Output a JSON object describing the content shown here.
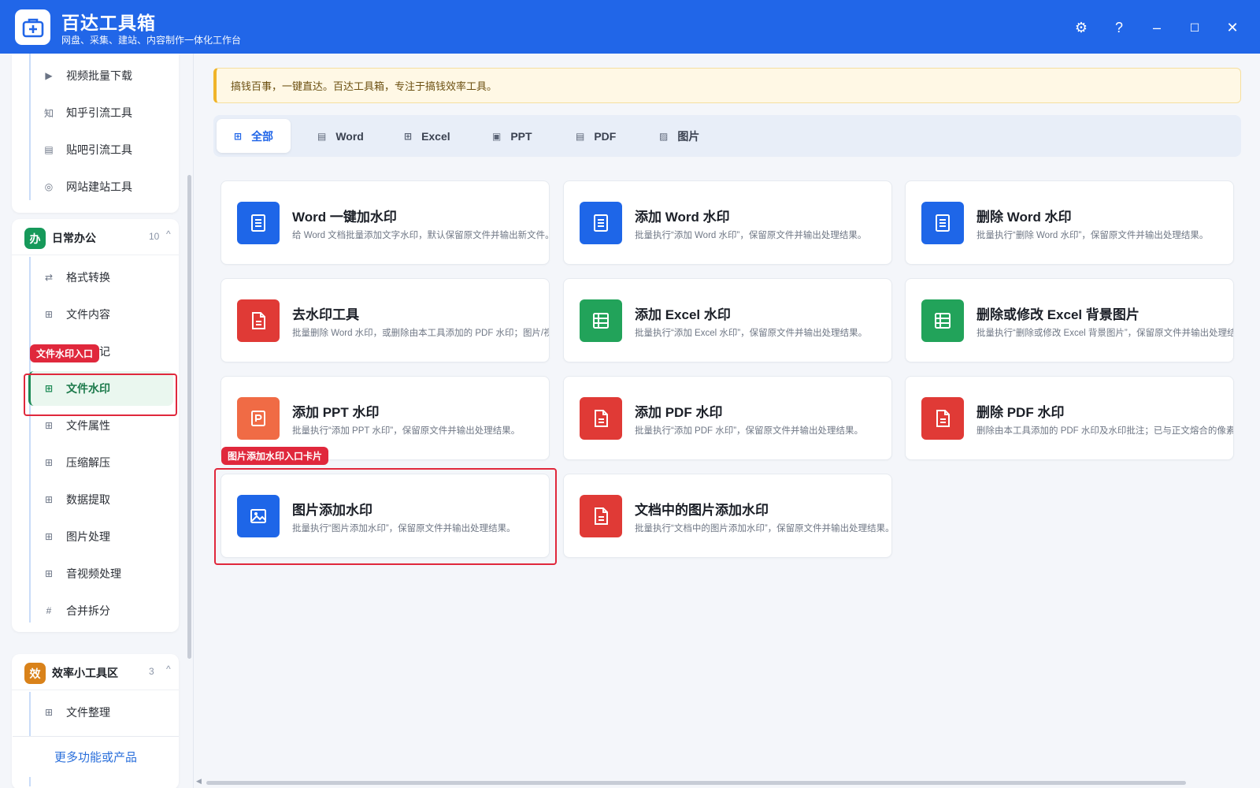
{
  "app": {
    "title": "百达工具箱",
    "subtitle": "网盘、采集、建站、内容制作一体化工作台"
  },
  "window_controls": {
    "settings": "⚙",
    "help": "?",
    "minimize": "–",
    "maximize": "☐",
    "close": "✕"
  },
  "sidebar": {
    "top_items": [
      {
        "label": "视频批量下载",
        "icon": "video-icon",
        "glyph": "▶"
      },
      {
        "label": "知乎引流工具",
        "icon": "zhihu-icon",
        "glyph": "知"
      },
      {
        "label": "贴吧引流工具",
        "icon": "tieba-icon",
        "glyph": "▤"
      },
      {
        "label": "网站建站工具",
        "icon": "globe-icon",
        "glyph": "◎"
      }
    ],
    "group_daily": {
      "badge": "办",
      "name": "日常办公",
      "count": "10",
      "caret": "^",
      "color": "#16995a",
      "items": [
        {
          "label": "格式转换",
          "icon": "convert-icon",
          "glyph": "⇄"
        },
        {
          "label": "文件内容",
          "icon": "grid-icon",
          "glyph": "⊞"
        },
        {
          "label": "文件标记",
          "icon": "grid-icon",
          "glyph": "⊞"
        },
        {
          "label": "文件水印",
          "icon": "grid-icon",
          "glyph": "⊞"
        },
        {
          "label": "文件属性",
          "icon": "grid-icon",
          "glyph": "⊞"
        },
        {
          "label": "压缩解压",
          "icon": "grid-icon",
          "glyph": "⊞"
        },
        {
          "label": "数据提取",
          "icon": "grid-icon",
          "glyph": "⊞"
        },
        {
          "label": "图片处理",
          "icon": "grid-icon",
          "glyph": "⊞"
        },
        {
          "label": "音视频处理",
          "icon": "grid-icon",
          "glyph": "⊞"
        },
        {
          "label": "合并拆分",
          "icon": "hash-icon",
          "glyph": "#"
        }
      ]
    },
    "group_efficiency": {
      "badge": "效",
      "name": "效率小工具区",
      "count": "3",
      "caret": "^",
      "color": "#d9821a",
      "items": [
        {
          "label": "文件整理",
          "icon": "grid-icon",
          "glyph": "⊞"
        }
      ]
    },
    "highlight_tag": "文件水印入口",
    "more_link": "更多功能或产品"
  },
  "notice": "搞钱百事，一键直达。百达工具箱，专注于搞钱效率工具。",
  "tabs": [
    {
      "label": "全部",
      "glyph": "⊞"
    },
    {
      "label": "Word",
      "glyph": "▤"
    },
    {
      "label": "Excel",
      "glyph": "⊞"
    },
    {
      "label": "PPT",
      "glyph": "▣"
    },
    {
      "label": "PDF",
      "glyph": "▤"
    },
    {
      "label": "图片",
      "glyph": "▨"
    }
  ],
  "active_tab": "全部",
  "cards": [
    {
      "title": "Word 一键加水印",
      "desc": "给 Word 文档批量添加文字水印，默认保留原文件并输出新文件。",
      "icon": "word-doc-icon",
      "color": "#1e66e8"
    },
    {
      "title": "添加 Word 水印",
      "desc": "批量执行“添加 Word 水印”，保留原文件并输出处理结果。",
      "icon": "word-doc-icon",
      "color": "#1e66e8"
    },
    {
      "title": "删除 Word 水印",
      "desc": "批量执行“删除 Word 水印”，保留原文件并输出处理结果。",
      "icon": "word-doc-icon",
      "color": "#1e66e8"
    },
    {
      "title": "去水印工具",
      "desc": "批量删除 Word 水印，或删除由本工具添加的 PDF 水印；图片/视频",
      "icon": "pdf-doc-icon",
      "color": "#e03a36"
    },
    {
      "title": "添加 Excel 水印",
      "desc": "批量执行“添加 Excel 水印”，保留原文件并输出处理结果。",
      "icon": "excel-sheet-icon",
      "color": "#22a35a"
    },
    {
      "title": "删除或修改 Excel 背景图片",
      "desc": "批量执行“删除或修改 Excel 背景图片”，保留原文件并输出处理结果。",
      "icon": "excel-sheet-icon",
      "color": "#22a35a"
    },
    {
      "title": "添加 PPT 水印",
      "desc": "批量执行“添加 PPT 水印”，保留原文件并输出处理结果。",
      "icon": "ppt-icon",
      "color": "#f06b45"
    },
    {
      "title": "添加 PDF 水印",
      "desc": "批量执行“添加 PDF 水印”，保留原文件并输出处理结果。",
      "icon": "pdf-doc-icon",
      "color": "#e03a36"
    },
    {
      "title": "删除 PDF 水印",
      "desc": "删除由本工具添加的 PDF 水印及水印批注；已与正文熔合的像素水印",
      "icon": "pdf-doc-icon",
      "color": "#e03a36"
    },
    {
      "title": "图片添加水印",
      "desc": "批量执行“图片添加水印”，保留原文件并输出处理结果。",
      "icon": "image-icon",
      "color": "#1e66e8"
    },
    {
      "title": "文档中的图片添加水印",
      "desc": "批量执行“文档中的图片添加水印”，保留原文件并输出处理结果。",
      "icon": "pdf-doc-icon",
      "color": "#e03a36"
    }
  ],
  "card_highlight_tag": "图片添加水印入口卡片"
}
